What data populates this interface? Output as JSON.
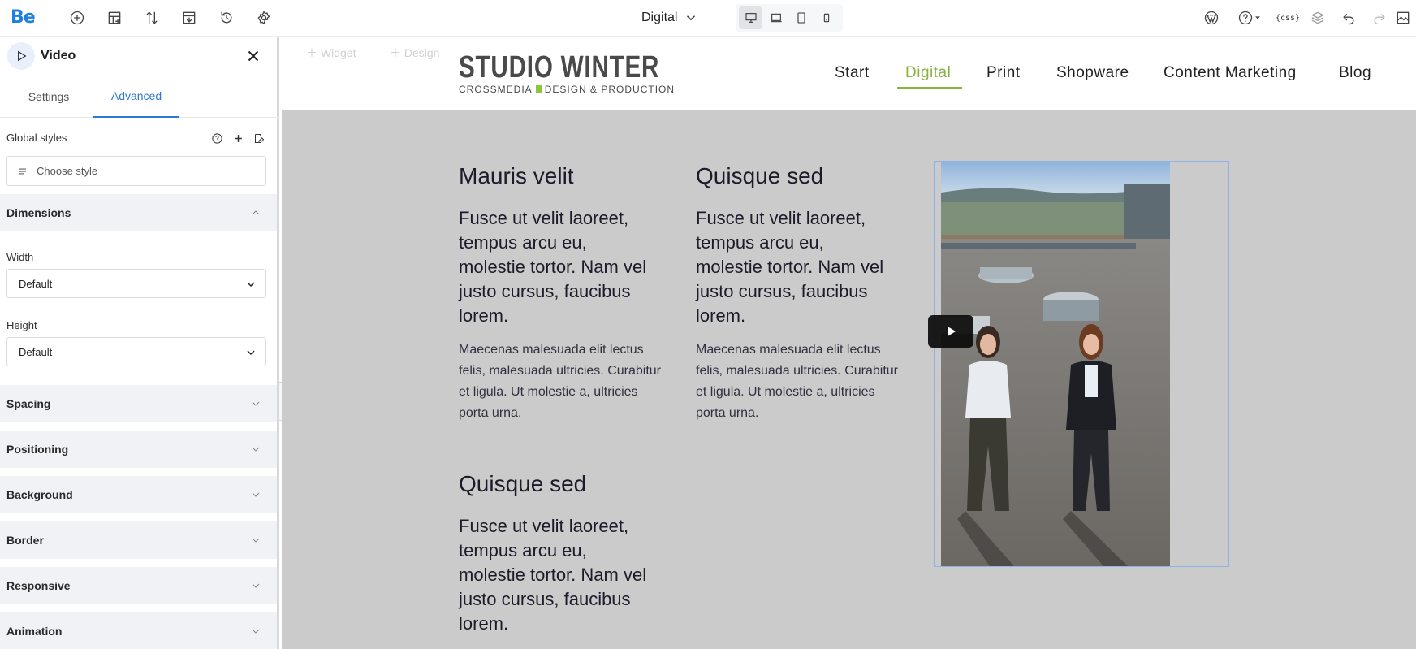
{
  "app": {
    "logo": "Be",
    "page_selector": "Digital"
  },
  "icons": {
    "toolbar_left": [
      "add-element-icon",
      "layout-icon",
      "sort-icon",
      "template-icon",
      "history-icon",
      "settings-icon"
    ],
    "toolbar_right": [
      "wordpress-icon",
      "help-icon",
      "css-icon",
      "layers-icon",
      "undo-icon",
      "redo-icon",
      "exit-icon"
    ],
    "devices": [
      "desktop-icon",
      "laptop-icon",
      "tablet-icon",
      "mobile-icon"
    ],
    "css_glyph": "{css}"
  },
  "panel": {
    "title": "Video",
    "tabs": [
      "Settings",
      "Advanced"
    ],
    "active_tab": "Advanced",
    "global_styles_label": "Global styles",
    "choose_style_placeholder": "Choose style",
    "dimensions": {
      "label": "Dimensions",
      "width_label": "Width",
      "width_value": "Default",
      "height_label": "Height",
      "height_value": "Default"
    },
    "sections": [
      "Spacing",
      "Positioning",
      "Background",
      "Border",
      "Responsive",
      "Animation"
    ]
  },
  "canvas": {
    "ghost_items": [
      "Widget",
      "Design"
    ],
    "brand": {
      "name": "STUDIO WINTER",
      "tag_left": "CROSSMEDIA",
      "tag_right": "DESIGN & PRODUCTION"
    },
    "nav": [
      "Start",
      "Digital",
      "Print",
      "Shopware",
      "Content Marketing",
      "Blog"
    ],
    "nav_active": "Digital",
    "colors": {
      "accent": "#8bb23f",
      "selection": "#8fb3e6",
      "canvas_bg": "#cbcbcb"
    },
    "columns": [
      {
        "title": "Mauris velit",
        "lead": "Fusce ut velit laoreet, tempus arcu eu, molestie tortor. Nam vel justo cursus, faucibus lorem.",
        "body": "Maecenas malesuada elit lectus felis, malesuada ultricies. Curabitur et ligula. Ut molestie a, ultricies porta urna."
      },
      {
        "title": "Quisque sed",
        "lead": "Fusce ut velit laoreet, tempus arcu eu, molestie tortor. Nam vel justo cursus, faucibus lorem.",
        "body": "Maecenas malesuada elit lectus felis, malesuada ultricies. Curabitur et ligula. Ut molestie a, ultricies porta urna."
      },
      {
        "title": "Quisque sed",
        "lead": "Fusce ut velit laoreet, tempus arcu eu, molestie tortor. Nam vel justo cursus, faucibus lorem."
      }
    ]
  }
}
